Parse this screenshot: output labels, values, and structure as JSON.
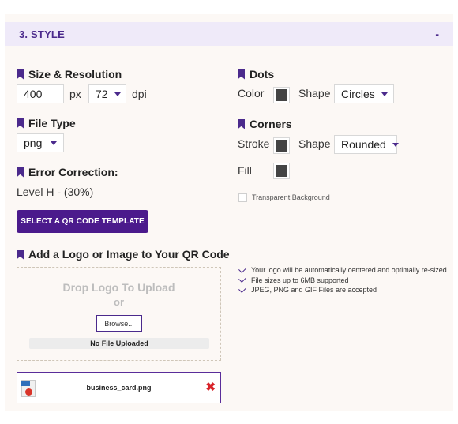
{
  "section": {
    "title": "3. STYLE",
    "toggle": "-"
  },
  "size_resolution": {
    "heading": "Size & Resolution",
    "size_value": "400",
    "size_unit": "px",
    "dpi_value": "72",
    "dpi_unit": "dpi"
  },
  "file_type": {
    "heading": "File Type",
    "value": "png"
  },
  "error_correction": {
    "heading": "Error Correction:",
    "value": "Level H - (30%)"
  },
  "template_button": {
    "label": "SELECT A QR CODE TEMPLATE"
  },
  "dots": {
    "heading": "Dots",
    "color_label": "Color",
    "color_value": "#444444",
    "shape_label": "Shape",
    "shape_value": "Circles"
  },
  "corners": {
    "heading": "Corners",
    "stroke_label": "Stroke",
    "stroke_color": "#444444",
    "shape_label": "Shape",
    "shape_value": "Rounded",
    "fill_label": "Fill",
    "fill_color": "#444444"
  },
  "transparent_background": {
    "label": "Transparent Background",
    "checked": false
  },
  "logo": {
    "heading": "Add a Logo or Image to Your QR Code",
    "drop_title": "Drop Logo To Upload",
    "drop_or": "or",
    "browse_label": "Browse...",
    "file_status": "No File Uploaded",
    "features": [
      "Your logo will be automatically centered and optimally re-sized",
      "File sizes up to 6MB supported",
      "JPEG, PNG and GIF Files are accepted"
    ],
    "uploaded_file": {
      "name": "business_card.png",
      "icon": "png-file-icon"
    }
  },
  "colors": {
    "accent": "#4b2a8c",
    "button": "#4b1a8c",
    "header_bg": "#efeaf9",
    "panel_bg": "#fcf8f5",
    "remove": "#d8232a"
  }
}
